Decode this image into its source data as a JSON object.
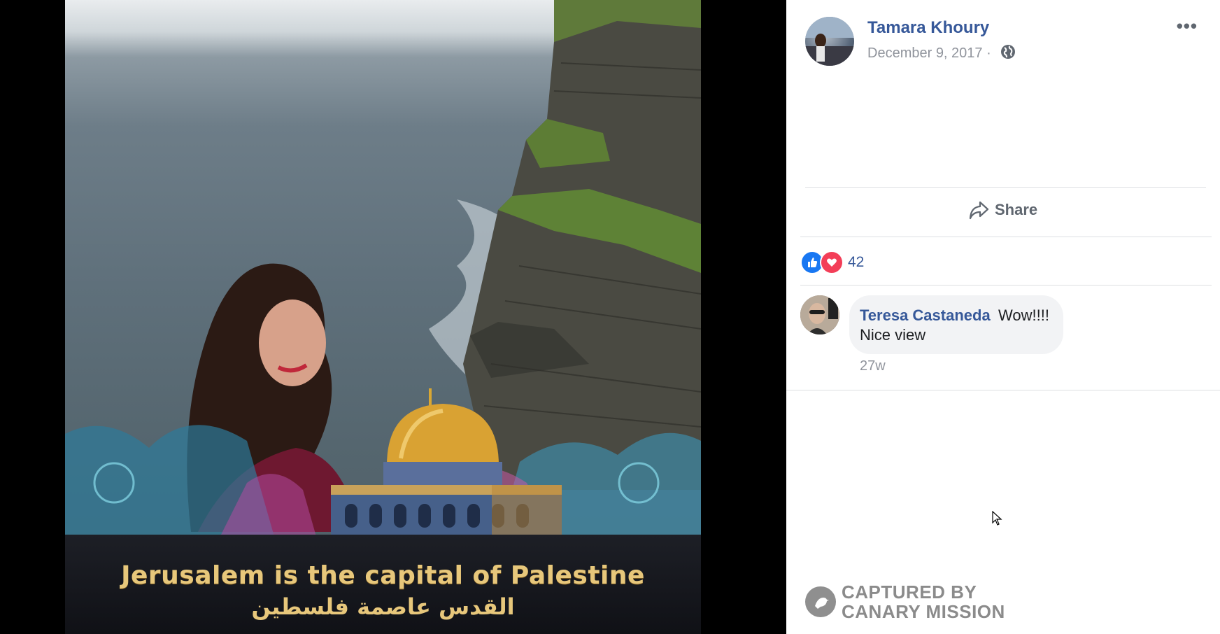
{
  "photo": {
    "caption_en": "Jerusalem is the capital of Palestine",
    "caption_ar": "القدس عاصمة فلسطين"
  },
  "post": {
    "author": "Tamara Khoury",
    "date": "December 9, 2017 ·",
    "more_icon": "•••",
    "privacy_icon": "globe-icon"
  },
  "actions": {
    "share_label": "Share",
    "share_icon": "share-arrow-icon"
  },
  "reactions": {
    "count": "42",
    "types": [
      "like",
      "love"
    ],
    "like_color": "#1877f2",
    "love_color": "#f33e58"
  },
  "comments": [
    {
      "author": "Teresa Castaneda",
      "text_line1": "Wow!!!!",
      "text_line2": "Nice view",
      "time": "27w"
    }
  ],
  "watermark": {
    "line1": "CAPTURED BY",
    "line2": "CANARY MISSION"
  },
  "colors": {
    "link": "#365899",
    "meta": "#90949c",
    "divider": "#dddfe2"
  }
}
